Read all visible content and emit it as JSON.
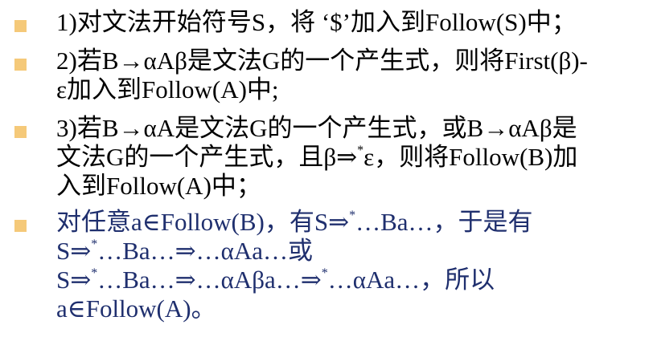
{
  "colors": {
    "bullet": "#F5C979",
    "text_black": "#000000",
    "text_blue": "#1F2F6E"
  },
  "items": [
    {
      "color": "#000000",
      "lines": [
        "1)对文法开始符号S，将 ‘$’加入到Follow(S)中；"
      ]
    },
    {
      "color": "#000000",
      "lines": [
        "2)若B→αAβ是文法G的一个产生式，则将First(β)-",
        "ε加入到Follow(A)中;"
      ]
    },
    {
      "color": "#000000",
      "lines": [
        [
          "3)若B→αA是文法G的一个产生式，或B→αAβ是"
        ],
        [
          "文法G的一个产生式，且β⇒",
          "*",
          "ε，则将Follow(B)加"
        ],
        [
          "入到Follow(A)中；"
        ]
      ]
    },
    {
      "color": "#1F2F6E",
      "lines": [
        [
          "对任意a∈Follow(B)，有S⇒",
          "*",
          "…Ba…，于是有"
        ],
        [
          "S⇒",
          "*",
          "…Ba…⇒…αAa…或"
        ],
        [
          "S⇒",
          "*",
          "…Ba…⇒…αAβa…⇒",
          "*",
          "…αAa…，所以"
        ],
        [
          "a∈Follow(A)。"
        ]
      ]
    }
  ]
}
